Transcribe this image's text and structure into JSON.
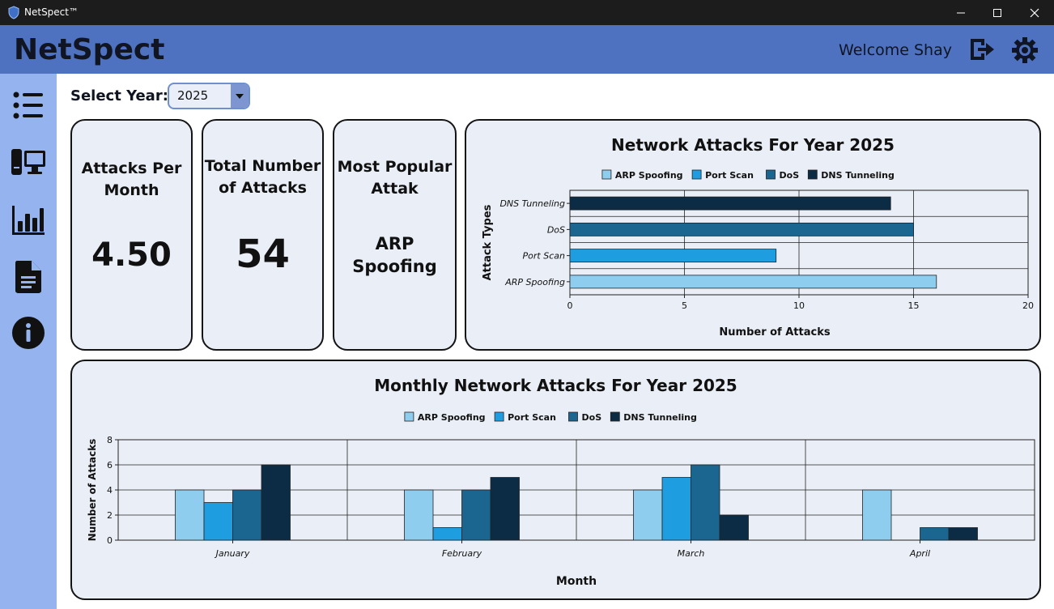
{
  "window": {
    "title": "NetSpect™"
  },
  "header": {
    "brand": "NetSpect",
    "welcome": "Welcome Shay"
  },
  "controls": {
    "year_label": "Select Year:",
    "year_value": "2025"
  },
  "stats": [
    {
      "title_line1": "Attacks Per",
      "title_line2": "Month",
      "value_line1": "4.50",
      "value_line2": ""
    },
    {
      "title_line1": "Total Number",
      "title_line2": "of Attacks",
      "value_line1": "54",
      "value_line2": ""
    },
    {
      "title_line1": "Most Popular",
      "title_line2": "Attak",
      "value_line1": "ARP",
      "value_line2": "Spoofing"
    }
  ],
  "colors": {
    "ARP Spoofing": "#8fcdee",
    "Port Scan": "#1e9de0",
    "DoS": "#1a6690",
    "DNS Tunneling": "#0b2c44",
    "header": "#4e72c0",
    "sidebar": "#94b3ef",
    "card": "#eaeef6"
  },
  "chart_data": [
    {
      "type": "bar",
      "orientation": "horizontal",
      "title": "Network Attacks For Year 2025",
      "xlabel": "Number of Attacks",
      "ylabel": "Attack Types",
      "categories": [
        "DNS Tunneling",
        "DoS",
        "Port Scan",
        "ARP Spoofing"
      ],
      "values": [
        14,
        15,
        9,
        16
      ],
      "legend": [
        "ARP Spoofing",
        "Port Scan",
        "DoS",
        "DNS Tunneling"
      ],
      "legend_position": "top-center",
      "xlim": [
        0,
        20
      ],
      "xticks": [
        0,
        5,
        10,
        15,
        20
      ],
      "grid": true
    },
    {
      "type": "bar",
      "orientation": "vertical",
      "title": "Monthly Network Attacks For Year 2025",
      "xlabel": "Month",
      "ylabel": "Number of Attacks",
      "categories": [
        "January",
        "February",
        "March",
        "April"
      ],
      "series": [
        {
          "name": "ARP Spoofing",
          "values": [
            4,
            4,
            4,
            4
          ]
        },
        {
          "name": "Port Scan",
          "values": [
            3,
            1,
            5,
            0
          ]
        },
        {
          "name": "DoS",
          "values": [
            4,
            4,
            6,
            1
          ]
        },
        {
          "name": "DNS Tunneling",
          "values": [
            6,
            5,
            2,
            1
          ]
        }
      ],
      "legend_position": "top-center",
      "ylim": [
        0,
        8
      ],
      "yticks": [
        0,
        2,
        4,
        6,
        8
      ],
      "grid": true
    }
  ]
}
